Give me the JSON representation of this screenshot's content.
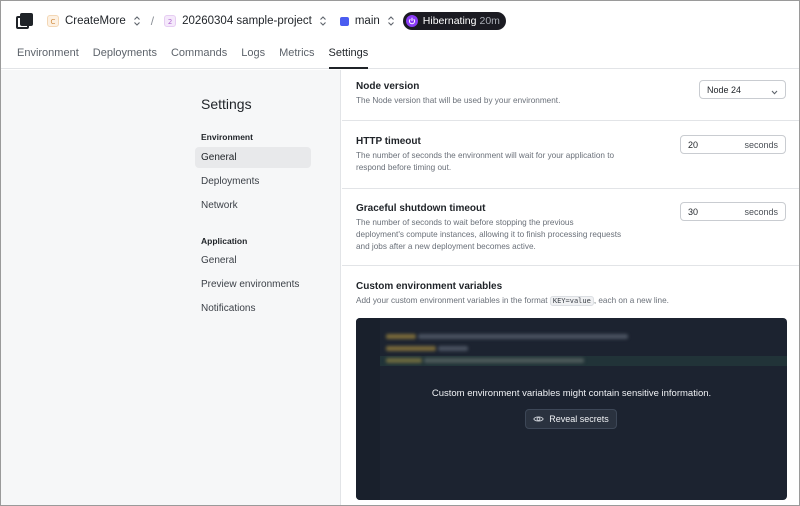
{
  "topbar": {
    "org_initial": "C",
    "org_name": "CreateMore",
    "separator": "/",
    "project_initial": "2",
    "project_name": "20260304 sample-project",
    "branch_name": "main",
    "status_label": "Hibernating",
    "status_time": "20m"
  },
  "tabs": [
    "Environment",
    "Deployments",
    "Commands",
    "Logs",
    "Metrics",
    "Settings"
  ],
  "active_tab": "Settings",
  "sidebar": {
    "title": "Settings",
    "groups": [
      {
        "label": "Environment",
        "items": [
          "General",
          "Deployments",
          "Network"
        ]
      },
      {
        "label": "Application",
        "items": [
          "General",
          "Preview environments",
          "Notifications"
        ]
      }
    ],
    "active_item": "General"
  },
  "main": {
    "node_version": {
      "title": "Node version",
      "description": "The Node version that will be used by your environment.",
      "value": "Node 24"
    },
    "http_timeout": {
      "title": "HTTP timeout",
      "description_1": "The number of seconds the environment will wait for your application to",
      "description_2": "respond before timing out.",
      "value": "20",
      "unit": "seconds"
    },
    "graceful_shutdown": {
      "title": "Graceful shutdown timeout",
      "description_1": "The number of seconds to wait before stopping the previous",
      "description_2": "deployment's compute instances, allowing it to finish processing requests",
      "description_3": "and jobs after a new deployment becomes active.",
      "value": "30",
      "unit": "seconds"
    },
    "env_vars": {
      "title": "Custom environment variables",
      "description_before": "Add your custom environment variables in the format",
      "format_chip": "KEY=value",
      "description_after": ", each on a new line.",
      "warning": "Custom environment variables might contain sensitive information.",
      "reveal_label": "Reveal secrets"
    }
  },
  "colors": {
    "accent": "#1f2328",
    "branch": "#4a5cf0",
    "hibernating": "#8b3cf7",
    "editor_bg": "#1c2330"
  }
}
